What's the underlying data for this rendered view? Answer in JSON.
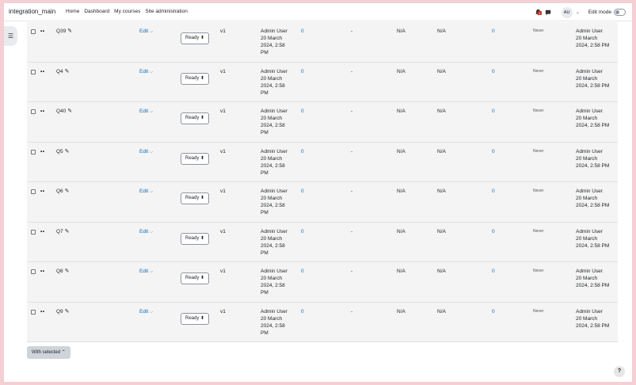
{
  "navbar": {
    "brand": "integration_main",
    "links": [
      "Home",
      "Dashboard",
      "My courses",
      "Site administration"
    ],
    "notification_count": "1",
    "avatar_initials": "AU",
    "edit_mode_label": "Edit mode"
  },
  "questions": [
    {
      "name": "Q39",
      "edit": "Edit",
      "status": "Ready",
      "version": "v1",
      "created_by": "Admin User",
      "created_on": "20 March 2024, 2:58 PM",
      "usage": "0",
      "comments": "-",
      "facility": "N/A",
      "discrimination": "N/A",
      "needs_checking": "0",
      "last_used": "Never",
      "modified_by": "Admin User",
      "modified_on": "20 March 2024, 2:58 PM"
    },
    {
      "name": "Q4",
      "edit": "Edit",
      "status": "Ready",
      "version": "v1",
      "created_by": "Admin User",
      "created_on": "20 March 2024, 2:58 PM",
      "usage": "0",
      "comments": "-",
      "facility": "N/A",
      "discrimination": "N/A",
      "needs_checking": "0",
      "last_used": "Never",
      "modified_by": "Admin User",
      "modified_on": "20 March 2024, 2:58 PM"
    },
    {
      "name": "Q40",
      "edit": "Edit",
      "status": "Ready",
      "version": "v1",
      "created_by": "Admin User",
      "created_on": "20 March 2024, 2:58 PM",
      "usage": "0",
      "comments": "-",
      "facility": "N/A",
      "discrimination": "N/A",
      "needs_checking": "0",
      "last_used": "Never",
      "modified_by": "Admin User",
      "modified_on": "20 March 2024, 2:58 PM"
    },
    {
      "name": "Q5",
      "edit": "Edit",
      "status": "Ready",
      "version": "v1",
      "created_by": "Admin User",
      "created_on": "20 March 2024, 2:58 PM",
      "usage": "0",
      "comments": "-",
      "facility": "N/A",
      "discrimination": "N/A",
      "needs_checking": "0",
      "last_used": "Never",
      "modified_by": "Admin User",
      "modified_on": "20 March 2024, 2:58 PM"
    },
    {
      "name": "Q6",
      "edit": "Edit",
      "status": "Ready",
      "version": "v1",
      "created_by": "Admin User",
      "created_on": "20 March 2024, 2:58 PM",
      "usage": "0",
      "comments": "-",
      "facility": "N/A",
      "discrimination": "N/A",
      "needs_checking": "0",
      "last_used": "Never",
      "modified_by": "Admin User",
      "modified_on": "20 March 2024, 2:58 PM"
    },
    {
      "name": "Q7",
      "edit": "Edit",
      "status": "Ready",
      "version": "v1",
      "created_by": "Admin User",
      "created_on": "20 March 2024, 2:58 PM",
      "usage": "0",
      "comments": "-",
      "facility": "N/A",
      "discrimination": "N/A",
      "needs_checking": "0",
      "last_used": "Never",
      "modified_by": "Admin User",
      "modified_on": "20 March 2024, 2:58 PM"
    },
    {
      "name": "Q8",
      "edit": "Edit",
      "status": "Ready",
      "version": "v1",
      "created_by": "Admin User",
      "created_on": "20 March 2024, 2:58 PM",
      "usage": "0",
      "comments": "-",
      "facility": "N/A",
      "discrimination": "N/A",
      "needs_checking": "0",
      "last_used": "Never",
      "modified_by": "Admin User",
      "modified_on": "20 March 2024, 2:58 PM"
    },
    {
      "name": "Q9",
      "edit": "Edit",
      "status": "Ready",
      "version": "v1",
      "created_by": "Admin User",
      "created_on": "20 March 2024, 2:58 PM",
      "usage": "0",
      "comments": "-",
      "facility": "N/A",
      "discrimination": "N/A",
      "needs_checking": "0",
      "last_used": "Never",
      "modified_by": "Admin User",
      "modified_on": "20 March 2024, 2:58 PM"
    }
  ],
  "bulk": {
    "with_selected_label": "With selected"
  },
  "help_label": "?",
  "colors": {
    "link": "#0f6cbf",
    "row_bg": "#f4f4f4",
    "frame_bg": "#f5cfd4"
  }
}
